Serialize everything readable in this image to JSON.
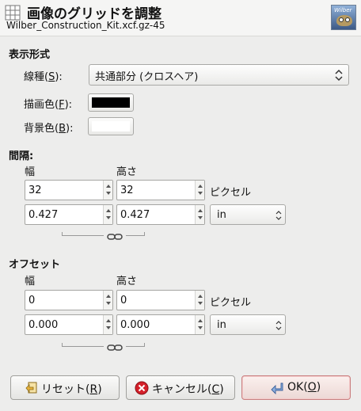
{
  "header": {
    "title": "画像のグリッドを調整",
    "subtitle": "Wilber_Construction_Kit.xcf.gz-45",
    "logo_text": "Wilber"
  },
  "display": {
    "section_title": "表示形式",
    "line_style_label": "線種(",
    "line_style_key": "S",
    "line_style_close": "):",
    "line_style_value": "共通部分 (クロスヘア)",
    "fg_label": "描画色(",
    "fg_key": "F",
    "fg_close": "):",
    "fg_color": "#000000",
    "bg_label": "背景色(",
    "bg_key": "B",
    "bg_close": "):",
    "bg_color": "#ffffff"
  },
  "spacing": {
    "section_title": "間隔:",
    "width_label": "幅",
    "height_label": "高さ",
    "pixel_width": "32",
    "pixel_height": "32",
    "pixel_unit": "ピクセル",
    "unit_width": "0.427",
    "unit_height": "0.427",
    "unit": "in"
  },
  "offset": {
    "section_title": "オフセット",
    "width_label": "幅",
    "height_label": "高さ",
    "pixel_x": "0",
    "pixel_y": "0",
    "pixel_unit": "ピクセル",
    "unit_x": "0.000",
    "unit_y": "0.000",
    "unit": "in"
  },
  "buttons": {
    "reset_label": "リセット(",
    "reset_key": "R",
    "cancel_label": "キャンセル(",
    "cancel_key": "C",
    "ok_label": "OK(",
    "ok_key": "O",
    "close": ")"
  },
  "colors": {
    "ok_border": "#c98080",
    "cancel_icon": "#d4202a",
    "reset_icon": "#e8b33a",
    "ok_icon": "#5b85c8"
  }
}
